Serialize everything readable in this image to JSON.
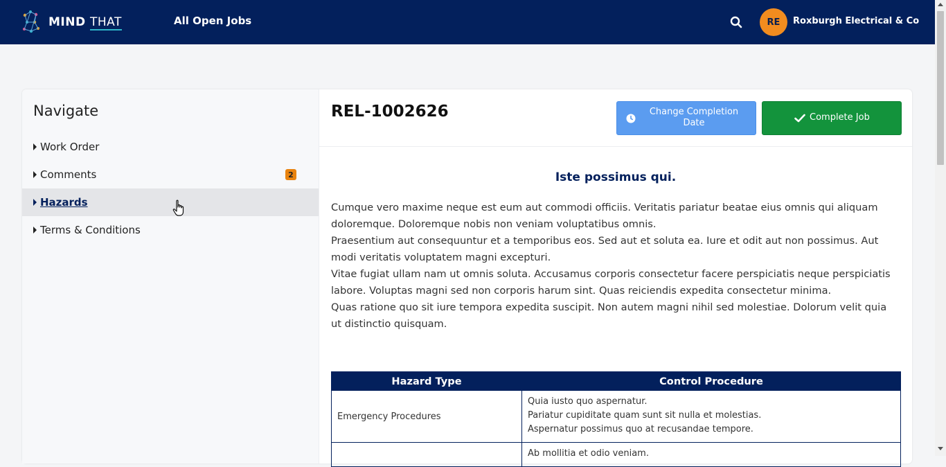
{
  "header": {
    "logo_bold": "MIND",
    "logo_thin": "THAT",
    "nav_link": "All Open Jobs",
    "avatar_initials": "RE",
    "org_name": "Roxburgh Electrical & Co",
    "accent_color": "#03205c",
    "avatar_color": "#f28c1f"
  },
  "sidebar": {
    "title": "Navigate",
    "items": [
      {
        "label": "Work Order"
      },
      {
        "label": "Comments",
        "badge": "2"
      },
      {
        "label": "Hazards",
        "active": true
      },
      {
        "label": "Terms & Conditions"
      }
    ]
  },
  "main": {
    "job_id": "REL-1002626",
    "change_date_button": "Change Completion Date",
    "complete_button": "Complete Job",
    "content_title": "Iste possimus qui.",
    "paragraphs": [
      "Cumque vero maxime neque est eum aut commodi officiis. Veritatis pariatur beatae eius omnis qui aliquam doloremque. Doloremque nobis non veniam voluptatibus omnis.",
      "Praesentium aut consequuntur et a temporibus eos. Sed aut et soluta ea. Iure et odit aut non possimus. Aut modi veritatis voluptatem magni excepturi.",
      "Vitae fugiat ullam nam ut omnis soluta. Accusamus corporis consectetur facere perspiciatis neque perspiciatis labore. Voluptas magni sed non corporis harum sint. Quas reiciendis expedita consectetur minima.",
      "Quas ratione quo sit iure tempora expedita suscipit. Non autem magni nihil sed molestiae. Dolorum velit quia ut distinctio quisquam."
    ],
    "table": {
      "headers": [
        "Hazard Type",
        "Control Procedure"
      ],
      "rows": [
        {
          "type": "Emergency Procedures",
          "control": [
            "Quia iusto quo aspernatur.",
            "Pariatur cupiditate quam sunt sit nulla et molestias.",
            "Aspernatur possimus quo at recusandae tempore."
          ]
        },
        {
          "type": "",
          "control": [
            "Ab mollitia et odio veniam."
          ]
        }
      ]
    }
  }
}
